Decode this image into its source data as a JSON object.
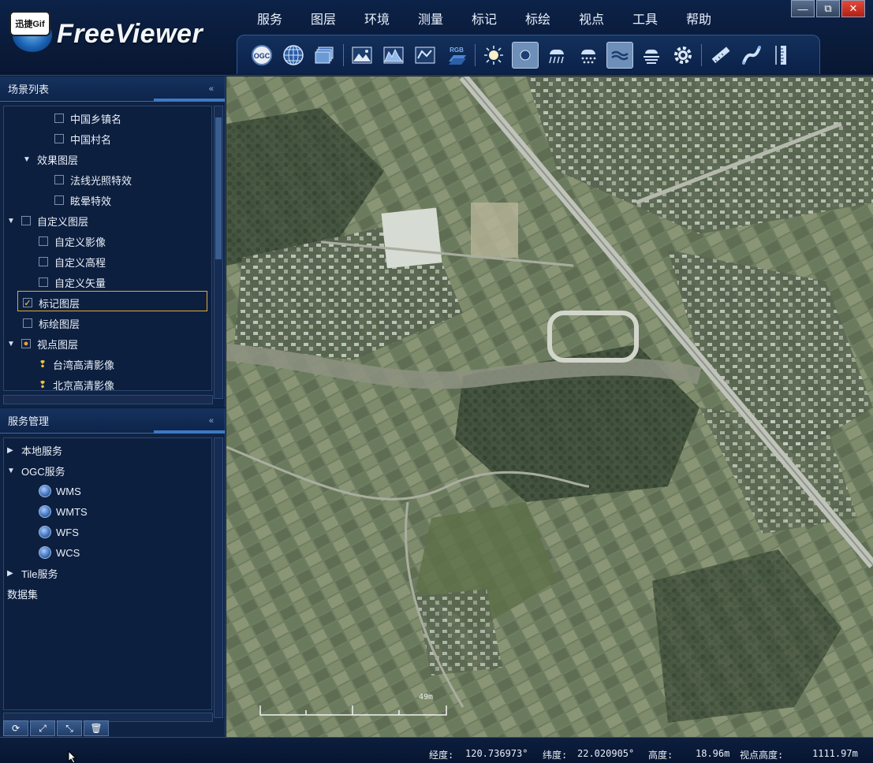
{
  "header": {
    "badge": "迅捷Gif",
    "logo_text": "FreeViewer",
    "menu": [
      "服务",
      "图层",
      "环境",
      "测量",
      "标记",
      "标绘",
      "视点",
      "工具",
      "帮助"
    ],
    "window_controls": [
      "—",
      "⧉",
      "✕"
    ]
  },
  "toolbar": {
    "tools": [
      {
        "icon": "ogc-icon",
        "label": "OGC",
        "active": false
      },
      {
        "icon": "globe-grid-icon",
        "active": false
      },
      {
        "icon": "layers-stack-icon",
        "active": false
      },
      {
        "icon": "terrain-image-icon",
        "active": false
      },
      {
        "icon": "elevation-icon",
        "active": false
      },
      {
        "icon": "vector-map-icon",
        "active": false
      },
      {
        "icon": "rgb-layer-icon",
        "label": "RGB",
        "active": false
      },
      {
        "icon": "sun-icon",
        "active": false
      },
      {
        "icon": "moon-icon",
        "active": true
      },
      {
        "icon": "rain-icon",
        "active": false
      },
      {
        "icon": "snow-icon",
        "active": false
      },
      {
        "icon": "water-icon",
        "active": true
      },
      {
        "icon": "fog-icon",
        "active": false
      },
      {
        "icon": "settings-gear-icon",
        "active": false
      },
      {
        "icon": "ruler-distance-icon",
        "active": false
      },
      {
        "icon": "ruler-path-icon",
        "active": false
      },
      {
        "icon": "ruler-height-icon",
        "active": false
      }
    ]
  },
  "scene_panel": {
    "title": "场景列表",
    "collapse_icon": "«",
    "items": [
      {
        "label": "中国乡镇名",
        "type": "checkbox",
        "checked": false,
        "level": 3
      },
      {
        "label": "中国村名",
        "type": "checkbox",
        "checked": false,
        "level": 3
      },
      {
        "label": "效果图层",
        "type": "expanded-group",
        "level": 1
      },
      {
        "label": "法线光照特效",
        "type": "checkbox",
        "checked": false,
        "level": 3
      },
      {
        "label": "眩晕特效",
        "type": "checkbox",
        "checked": false,
        "level": 3
      },
      {
        "label": "自定义图层",
        "type": "expanded-group-checkbox",
        "checked": false,
        "level": 0
      },
      {
        "label": "自定义影像",
        "type": "checkbox",
        "checked": false,
        "level": 2
      },
      {
        "label": "自定义高程",
        "type": "checkbox",
        "checked": false,
        "level": 2
      },
      {
        "label": "自定义矢量",
        "type": "checkbox",
        "checked": false,
        "level": 2
      },
      {
        "label": "标记图层",
        "type": "checkbox",
        "checked": true,
        "level": 1,
        "selected": true
      },
      {
        "label": "标绘图层",
        "type": "checkbox",
        "checked": false,
        "level": 1
      },
      {
        "label": "视点图层",
        "type": "expanded-group-pin",
        "level": 0
      },
      {
        "label": "台湾高清影像",
        "type": "pin",
        "level": 2
      },
      {
        "label": "北京高清影像",
        "type": "pin",
        "level": 2
      }
    ]
  },
  "service_panel": {
    "title": "服务管理",
    "collapse_icon": "«",
    "items": [
      {
        "label": "本地服务",
        "type": "collapsed-group",
        "level": 0
      },
      {
        "label": "OGC服务",
        "type": "expanded-group",
        "level": 0
      },
      {
        "label": "WMS",
        "type": "globe",
        "level": 2
      },
      {
        "label": "WMTS",
        "type": "globe",
        "level": 2
      },
      {
        "label": "WFS",
        "type": "globe",
        "level": 2
      },
      {
        "label": "WCS",
        "type": "globe",
        "level": 2
      },
      {
        "label": "Tile服务",
        "type": "collapsed-group",
        "level": 0
      },
      {
        "label": "数据集",
        "type": "plain",
        "level": 0
      }
    ]
  },
  "bottom_buttons": [
    {
      "icon": "refresh-icon",
      "glyph": "⟳"
    },
    {
      "icon": "expand-icon",
      "glyph": "⤢"
    },
    {
      "icon": "collapse-icon",
      "glyph": "⤡"
    },
    {
      "icon": "trash-icon",
      "glyph": "🗑"
    }
  ],
  "map": {
    "scale_label": "49m"
  },
  "status": {
    "lon_label": "经度:",
    "lon_value": "120.736973°",
    "lat_label": "纬度:",
    "lat_value": "22.020905°",
    "height_label": "高度:",
    "height_value": "18.96m",
    "view_height_label": "视点高度:",
    "view_height_value": "1111.97m"
  },
  "colors": {
    "accent": "#3d78c4",
    "selection_border": "#e0a93a",
    "panel_bg": "#0f2344"
  }
}
